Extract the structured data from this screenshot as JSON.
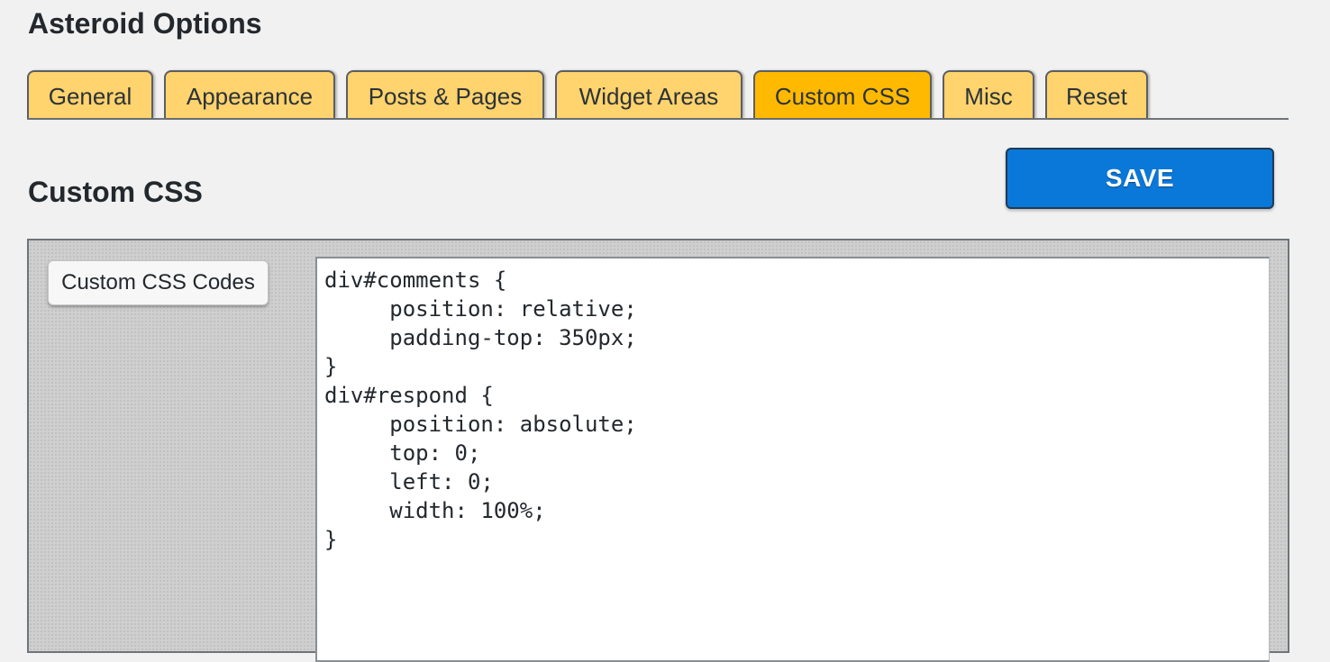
{
  "header": {
    "title": "Asteroid Options"
  },
  "tabs": [
    {
      "label": "General",
      "active": false
    },
    {
      "label": "Appearance",
      "active": false
    },
    {
      "label": "Posts & Pages",
      "active": false
    },
    {
      "label": "Widget Areas",
      "active": false
    },
    {
      "label": "Custom CSS",
      "active": true
    },
    {
      "label": "Misc",
      "active": false
    },
    {
      "label": "Reset",
      "active": false
    }
  ],
  "section": {
    "title": "Custom CSS",
    "save_label": "SAVE"
  },
  "field": {
    "label": "Custom CSS Codes",
    "value": "div#comments {\n     position: relative;\n     padding-top: 350px;\n}\ndiv#respond {\n     position: absolute;\n     top: 0;\n     left: 0;\n     width: 100%;\n}"
  },
  "colors": {
    "tab": "#ffd36d",
    "tab_active": "#ffb900",
    "save_button": "#0a78d8",
    "background": "#f1f1f1"
  }
}
